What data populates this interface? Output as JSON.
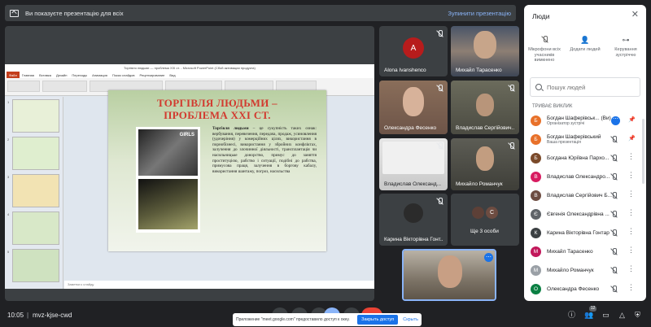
{
  "presenting_bar": {
    "message": "Ви показуєте презентацію для всіх",
    "stop_label": "Зупинити презентацію"
  },
  "powerpoint": {
    "window_title": "Торгівля людьми — проблема XXI ст. - Microsoft PowerPoint (Сбой активации продукта)",
    "tabs": [
      "Файл",
      "Главная",
      "Вставка",
      "Дизайн",
      "Переходы",
      "Анимация",
      "Показ слайдов",
      "Рецензирование",
      "Вид"
    ],
    "notes_placeholder": "Заметки к слайду",
    "thumb_numbers": [
      "1",
      "2",
      "3",
      "4",
      "5"
    ],
    "slide": {
      "title_line1": "ТОРГІВЛЯ ЛЮДЬМИ –",
      "title_line2": "ПРОБЛЕМА XXI СТ.",
      "image_label": "GIRLS",
      "body_lead": "Торгівля людьми",
      "body_text": " – це сукупність таких ознак: вербування, перевезення, передача, продаж, усиновлення (удочеріння) у комерційних цілях, використання в порнобізнесі, використання у збройних конфліктах, залучення до злочинної діяльності, трансплантація чи насильницьке донорство, примус до заняття проституцією, рабство і ситуації, подібні до рабства, примусова праця, залучення в боргову кабалу, використання шантажу, погроз, насильства"
    }
  },
  "tiles": [
    {
      "name": "Alona Ivanshenco",
      "initial": "A"
    },
    {
      "name": "Михайл Тарасенко"
    },
    {
      "name": "Олександра Фесенко"
    },
    {
      "name": "Владислав Сергійович..."
    },
    {
      "name": "Владислав Олександ..."
    },
    {
      "name": "Михайло Романчук"
    },
    {
      "name": "Карина Вікторівна Гонт..."
    },
    {
      "name": "Ще 3 особи",
      "initial": "C"
    }
  ],
  "panel": {
    "title": "Люди",
    "actions": [
      {
        "icon": "mic-off-icon",
        "label": "Мікрофони всіх учасників вимкнено"
      },
      {
        "icon": "add-person-icon",
        "label": "Додати людей"
      },
      {
        "icon": "toggle-icon",
        "label": "Керування зустріччю"
      }
    ],
    "search_placeholder": "Пошук людей",
    "section_label": "ТРИВАЄ ВИКЛИК",
    "people": [
      {
        "initial": "Б",
        "color": "#e8712a",
        "name": "Богдан Шаферівськ... (Ви)",
        "sub": "Організатор зустрічі"
      },
      {
        "initial": "Б",
        "color": "#e8712a",
        "name": "Богдан Шаферівський",
        "sub": "Ваша презентація"
      },
      {
        "initial": "Б",
        "color": "#7b4a2a",
        "name": "Богдана Юріївна Пархо..."
      },
      {
        "initial": "В",
        "color": "#d81b60",
        "name": "Владислав Олександро..."
      },
      {
        "initial": "В",
        "color": "#6d4c41",
        "name": "Владислав Сергійович Б..."
      },
      {
        "initial": "Є",
        "color": "#5f6368",
        "name": "Євгенія Олександрівна ..."
      },
      {
        "initial": "К",
        "color": "#3c4043",
        "name": "Карина Вікторівна Гонтар"
      },
      {
        "initial": "М",
        "color": "#c2185b",
        "name": "Михайл Тарасенко"
      },
      {
        "initial": "М",
        "color": "#9aa0a6",
        "name": "Михайло Романчук"
      },
      {
        "initial": "О",
        "color": "#0b8043",
        "name": "Олександра Фесенко"
      }
    ]
  },
  "bottom": {
    "time": "10:05",
    "separator": "|",
    "meeting_code": "mvz-kjse-cwd",
    "people_count": "12"
  },
  "share_notice": {
    "message": "Приложение \"meet.google.com\" предоставило доступ к окну.",
    "hide_label": "Закрыть доступ",
    "cancel_label": "Скрыть"
  }
}
